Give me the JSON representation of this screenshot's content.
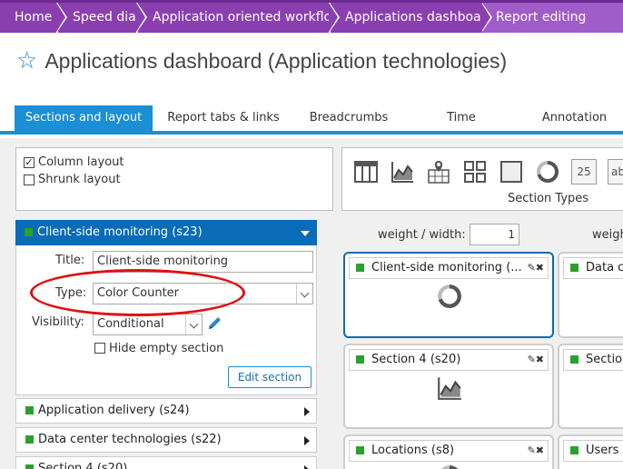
{
  "breadcrumbs": [
    {
      "label": "Home",
      "color": "#8a3fb0"
    },
    {
      "label": "Speed dial",
      "color": "#8a3fb0"
    },
    {
      "label": "Application oriented workflow",
      "color": "#8a3fb0"
    },
    {
      "label": "Applications dashboard",
      "color": "#8a3fb0"
    },
    {
      "label": "Report editing",
      "color": "#a05cc8"
    }
  ],
  "page_title": "Applications dashboard (Application technologies)",
  "tabs": [
    {
      "label": "Sections and layout",
      "active": true
    },
    {
      "label": "Report tabs & links"
    },
    {
      "label": "Breadcrumbs"
    },
    {
      "label": "Time"
    },
    {
      "label": "Annotation"
    }
  ],
  "layout_options": {
    "column_layout": {
      "label": "Column layout",
      "checked": true
    },
    "shrunk_layout": {
      "label": "Shrunk layout",
      "checked": false
    }
  },
  "active_section": {
    "header": "Client-side monitoring (s23)",
    "title_label": "Title:",
    "title_value": "Client-side monitoring",
    "type_label": "Type:",
    "type_value": "Color Counter",
    "visibility_label": "Visibility:",
    "visibility_value": "Conditional",
    "hide_empty_label": "Hide empty section",
    "hide_empty_checked": false,
    "edit_button": "Edit section"
  },
  "sections": [
    {
      "label": "Application delivery (s24)"
    },
    {
      "label": "Data center technologies (s22)"
    },
    {
      "label": "Section 4 (s20)"
    }
  ],
  "section_types": {
    "label": "Section Types",
    "icons": [
      "table-icon",
      "line-chart-icon",
      "map-icon",
      "tiles-icon",
      "blank-icon",
      "donut-icon",
      "number-icon",
      "text-icon"
    ],
    "number_text": "25",
    "text_text": "ab"
  },
  "layout": {
    "weight_label": "weight / width:",
    "weight_value": "1",
    "weight_label_2": "weigh",
    "cards": [
      {
        "label": "Client-side monitoring (...",
        "icon": "donut-icon",
        "selected": true
      },
      {
        "label": "Data c",
        "icon": ""
      },
      {
        "label": "Section 4 (s20)",
        "icon": "line-chart-icon"
      },
      {
        "label": "Sectio",
        "icon": ""
      },
      {
        "label": "Locations (s8)",
        "icon": "donut-icon"
      },
      {
        "label": "Users (",
        "icon": ""
      }
    ],
    "tools": "✎✖"
  },
  "colors": {
    "accent": "#1a8ed6",
    "active_header": "#0a6bb8",
    "status_green": "#2ca02c",
    "annotation_red": "#e01010"
  }
}
